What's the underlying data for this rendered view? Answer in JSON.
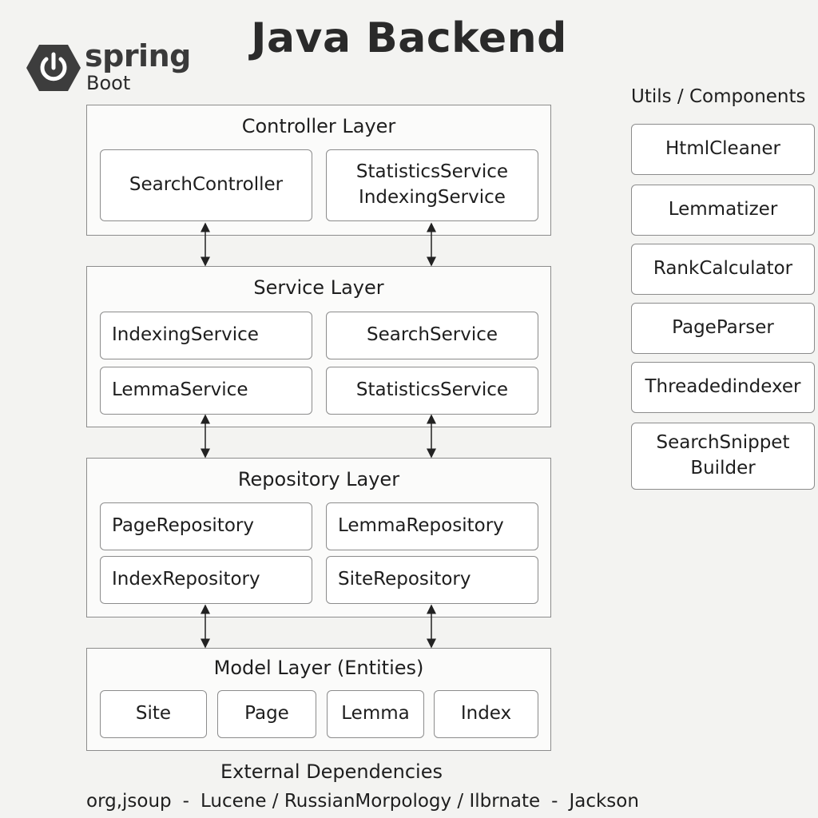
{
  "title": "Java Backend",
  "brand": {
    "name": "spring",
    "sub": "Boot",
    "icon": "power-icon"
  },
  "layers": {
    "controller": {
      "title": "Controller Layer",
      "boxes": [
        "SearchController",
        "StatisticsService",
        "IndexingService"
      ]
    },
    "service": {
      "title": "Service Layer",
      "boxes": [
        "IndexingService",
        "SearchService",
        "LemmaService",
        "StatisticsService"
      ]
    },
    "repository": {
      "title": "Repository Layer",
      "boxes": [
        "PageRepository",
        "LemmaRepository",
        "IndexRepository",
        "SiteRepository"
      ]
    },
    "model": {
      "title": "Model Layer (Entities)",
      "boxes": [
        "Site",
        "Page",
        "Lemma",
        "Index"
      ]
    }
  },
  "utils": {
    "title": "Utils / Components",
    "items": [
      "HtmlCleaner",
      "Lemmatizer",
      "RankCalculator",
      "PageParser",
      "Threadedindexer",
      "SearchSnippet",
      "Builder"
    ]
  },
  "deps": {
    "title": "External Dependencies",
    "items": [
      "org,jsoup",
      "-",
      "Lucene / RussianMorpology / Ilbrnate",
      "-",
      "Jackson"
    ]
  },
  "colors": {
    "border": "#8c8c8c",
    "background": "#f3f3f1",
    "logo": "#3d3d3d"
  }
}
